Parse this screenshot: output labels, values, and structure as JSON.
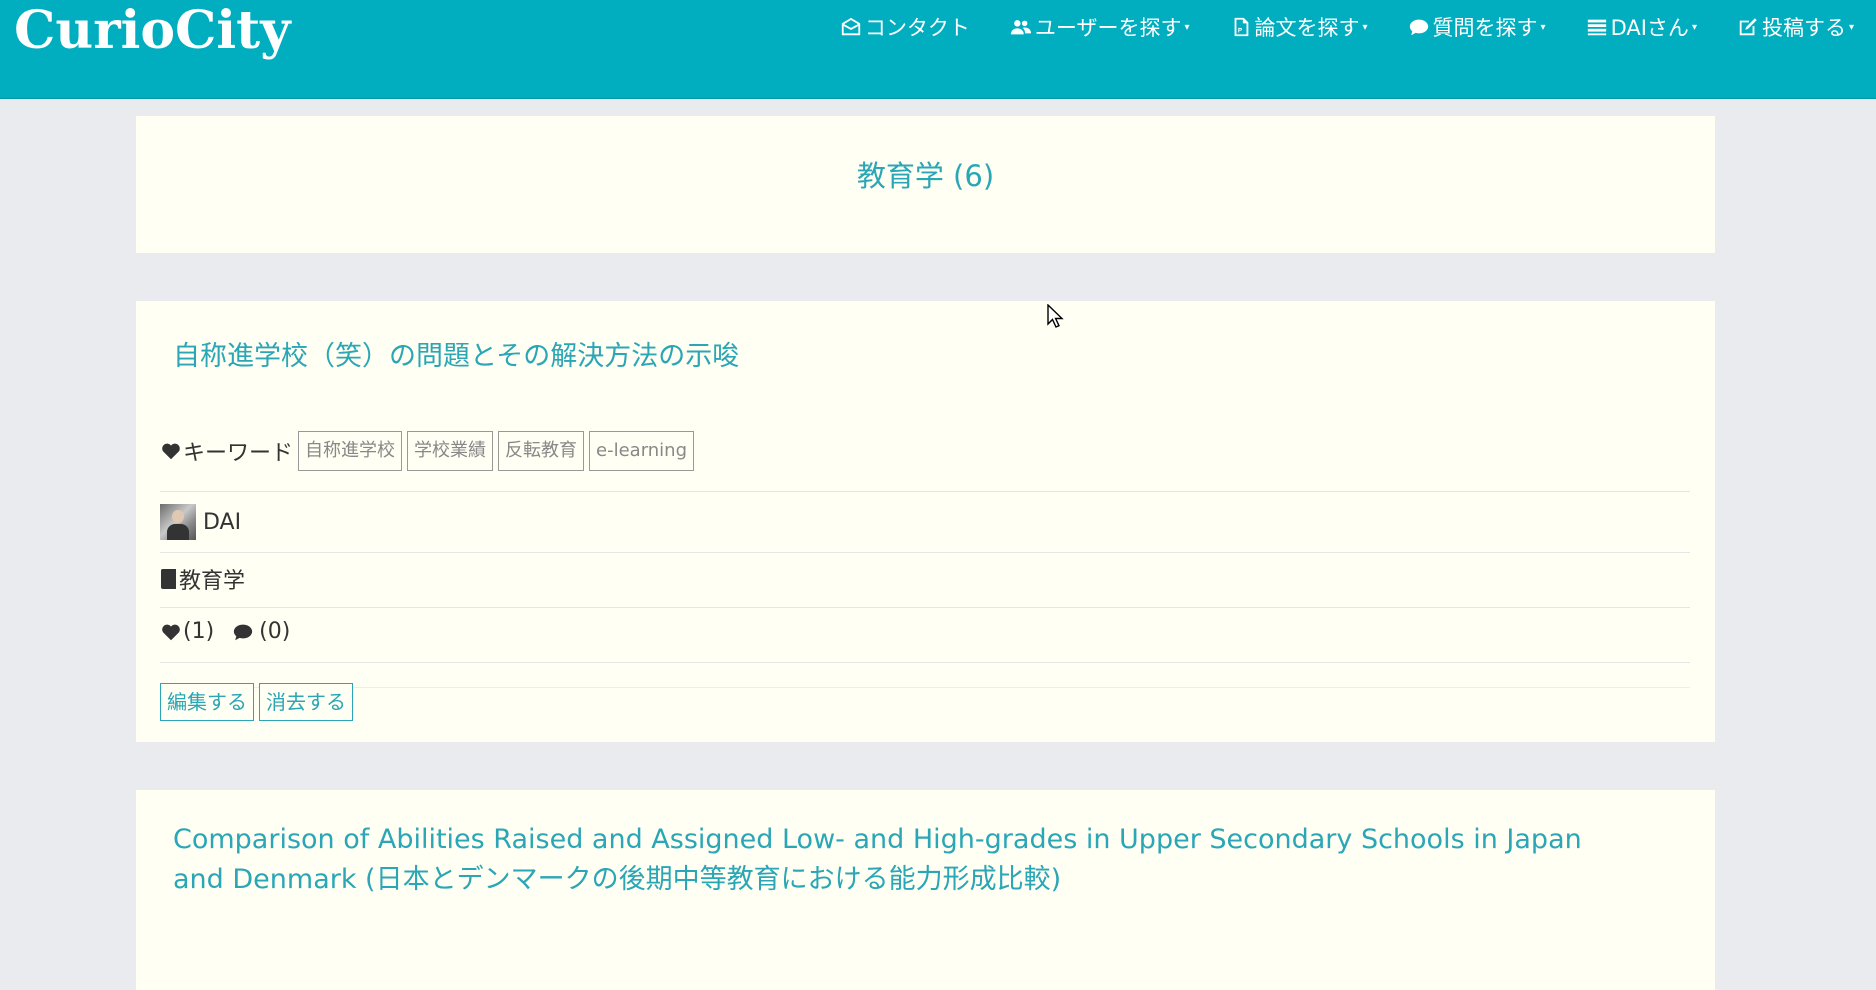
{
  "navbar": {
    "brand": "CurioCity",
    "items": [
      {
        "label": "コンタクト",
        "icon": "envelope-open-icon",
        "caret": false
      },
      {
        "label": "ユーザーを探す",
        "icon": "users-icon",
        "caret": true
      },
      {
        "label": "論文を探す",
        "icon": "file-pdf-icon",
        "caret": true
      },
      {
        "label": "質問を探す",
        "icon": "comments-icon",
        "caret": true
      },
      {
        "label": "DAIさん",
        "icon": "list-icon",
        "caret": true
      },
      {
        "label": "投稿する",
        "icon": "edit-icon",
        "caret": true
      }
    ]
  },
  "category": {
    "title": "教育学 (6)"
  },
  "papers": [
    {
      "title": "自称進学校（笑）の問題とその解決方法の示唆",
      "keywords_label": "キーワード",
      "keywords": [
        "自称進学校",
        "学校業績",
        "反転教育",
        "e-learning"
      ],
      "author": "DAI",
      "field": "教育学",
      "likes": "(1)",
      "comments": "(0)",
      "edit_label": "編集する",
      "delete_label": "消去する"
    },
    {
      "title": "Comparison of Abilities Raised and Assigned Low- and High-grades in Upper Secondary Schools in Japan and Denmark (日本とデンマークの後期中等教育における能力形成比較)"
    }
  ],
  "colors": {
    "navbar_bg": "#00aebf",
    "accent": "#2aa6b6",
    "card_bg": "#fffff3",
    "page_bg": "#e9ebee"
  }
}
